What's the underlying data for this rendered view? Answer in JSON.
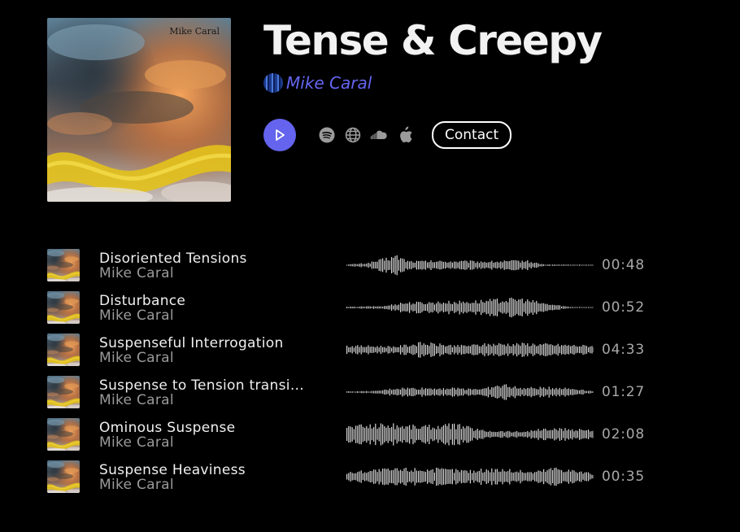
{
  "album": {
    "title": "Tense & Creepy",
    "cover_label": "Mike Caral",
    "artist": "Mike Caral"
  },
  "controls": {
    "play_icon": "play-icon",
    "platforms": [
      {
        "name": "spotify-icon"
      },
      {
        "name": "globe-icon"
      },
      {
        "name": "soundcloud-icon"
      },
      {
        "name": "apple-icon"
      }
    ],
    "contact_label": "Contact"
  },
  "colors": {
    "accent": "#6464ee",
    "artist_link": "#6565f2",
    "background": "#000000"
  },
  "tracks": [
    {
      "title": "Disoriented Tensions",
      "artist": "Mike Caral",
      "duration": "00:48"
    },
    {
      "title": "Disturbance",
      "artist": "Mike Caral",
      "duration": "00:52"
    },
    {
      "title": "Suspenseful Interrogation",
      "artist": "Mike Caral",
      "duration": "04:33"
    },
    {
      "title": "Suspense to Tension transi…",
      "artist": "Mike Caral",
      "duration": "01:27"
    },
    {
      "title": "Ominous Suspense",
      "artist": "Mike Caral",
      "duration": "02:08"
    },
    {
      "title": "Suspense Heaviness",
      "artist": "Mike Caral",
      "duration": "00:35"
    }
  ]
}
